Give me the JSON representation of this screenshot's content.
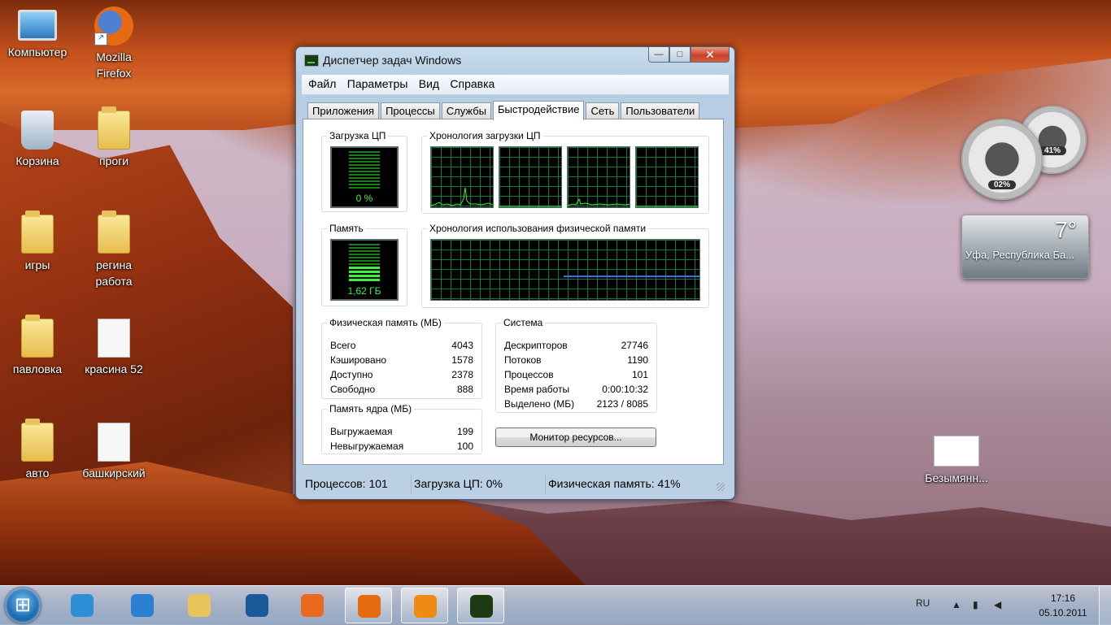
{
  "desktop": {
    "icons": [
      {
        "label": "Компьютер"
      },
      {
        "label": "Mozilla Firefox"
      },
      {
        "label": "Корзина"
      },
      {
        "label": "проги"
      },
      {
        "label": "игры"
      },
      {
        "label": "регина работа"
      },
      {
        "label": "павловка"
      },
      {
        "label": "красина 52"
      },
      {
        "label": "авто"
      },
      {
        "label": "башкирский"
      },
      {
        "label": "Безымянн..."
      }
    ]
  },
  "gadgets": {
    "cpu_gauge": {
      "cpu_value": "02%",
      "memory_value": "41%"
    },
    "weather": {
      "temperature": "7°",
      "city": "Уфа, Республика Ба..."
    }
  },
  "window": {
    "title": "Диспетчер задач Windows",
    "caption": {
      "minimize": "—",
      "maximize": "□",
      "close": "✕"
    },
    "menu": [
      "Файл",
      "Параметры",
      "Вид",
      "Справка"
    ],
    "tabs": [
      "Приложения",
      "Процессы",
      "Службы",
      "Быстродействие",
      "Сеть",
      "Пользователи"
    ],
    "active_tab": "Быстродействие",
    "cpu": {
      "label": "Загрузка ЦП",
      "value": "0 %",
      "history_label": "Хронология загрузки ЦП",
      "load_fraction": 0.0
    },
    "memory": {
      "label": "Память",
      "value": "1,62 ГБ",
      "history_label": "Хронология использования физической памяти",
      "usage_fraction": 0.41
    },
    "physical_memory": {
      "title": "Физическая память (МБ)",
      "rows": [
        {
          "label": "Всего",
          "value": "4043"
        },
        {
          "label": "Кэшировано",
          "value": "1578"
        },
        {
          "label": "Доступно",
          "value": "2378"
        },
        {
          "label": "Свободно",
          "value": "888"
        }
      ]
    },
    "kernel_memory": {
      "title": "Память ядра (МБ)",
      "rows": [
        {
          "label": "Выгружаемая",
          "value": "199"
        },
        {
          "label": "Невыгружаемая",
          "value": "100"
        }
      ]
    },
    "system": {
      "title": "Система",
      "rows": [
        {
          "label": "Дескрипторов",
          "value": "27746"
        },
        {
          "label": "Потоков",
          "value": "1190"
        },
        {
          "label": "Процессов",
          "value": "101"
        },
        {
          "label": "Время работы",
          "value": "0:00:10:32"
        },
        {
          "label": "Выделено (МБ)",
          "value": "2123 / 8085"
        }
      ]
    },
    "resource_monitor_button": "Монитор ресурсов...",
    "status": {
      "processes": "Процессов: 101",
      "cpu": "Загрузка ЦП: 0%",
      "memory": "Физическая память: 41%"
    }
  },
  "taskbar": {
    "language": "RU",
    "time": "17:16",
    "date": "05.10.2011",
    "buttons": [
      {
        "name": "media-player",
        "color": "#2f8fd6"
      },
      {
        "name": "internet-explorer",
        "color": "#2b7fd0"
      },
      {
        "name": "windows-explorer",
        "color": "#e9c45a"
      },
      {
        "name": "hp",
        "color": "#1a5a9a"
      },
      {
        "name": "app",
        "color": "#e96a1c"
      },
      {
        "name": "firefox",
        "color": "#e66a12"
      },
      {
        "name": "mail-agent",
        "color": "#f08a12"
      },
      {
        "name": "task-manager",
        "color": "#1d3b12"
      }
    ]
  }
}
